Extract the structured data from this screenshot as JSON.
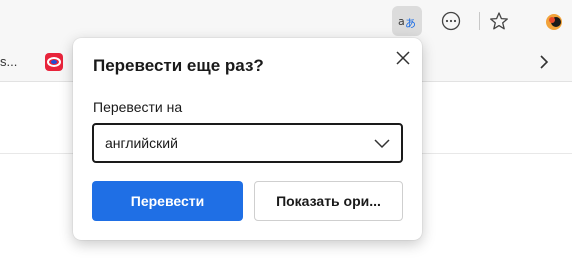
{
  "toolbar": {
    "icons": [
      "translate-icon",
      "more-icon",
      "favorite-star-icon",
      "profile-icon"
    ],
    "accent": "#dcdcdc"
  },
  "favorites": {
    "truncated_text": "s...",
    "items": [
      "favorite-site-icon",
      "chevron-right-icon"
    ]
  },
  "popup": {
    "title": "Перевести еще раз?",
    "label": "Перевести на",
    "selected_language": "английский",
    "translate_button": "Перевести",
    "show_original_button": "Показать ори...",
    "primary_color": "#1f6fe5"
  }
}
